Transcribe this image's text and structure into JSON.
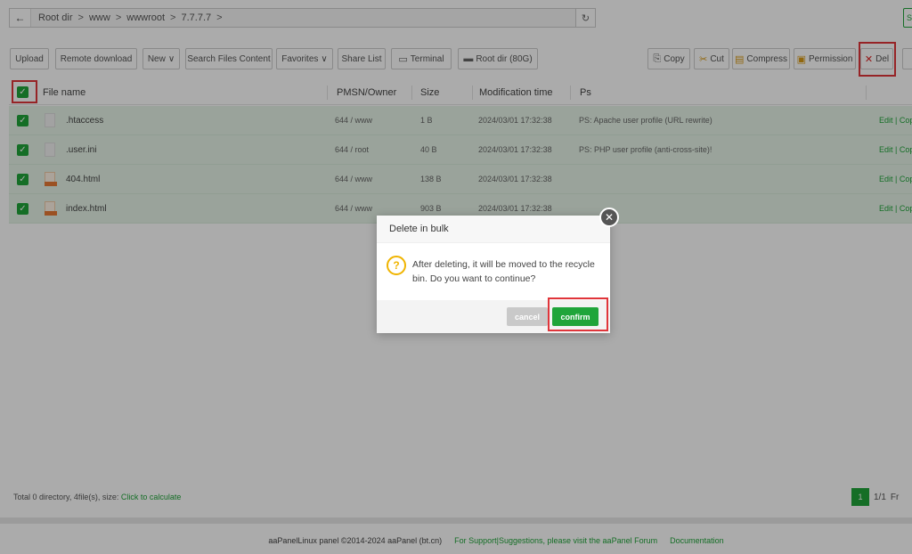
{
  "address_bar": {
    "back_icon": "arrow-left-icon",
    "crumbs": [
      "Root dir",
      "www",
      "wwwroot",
      "7.7.7.7"
    ],
    "separator": ">",
    "refresh_icon": "refresh-icon"
  },
  "corner_button": {
    "label": "S"
  },
  "toolbar": {
    "upload": "Upload",
    "remote_download": "Remote download",
    "new": "New",
    "search_files_content": "Search Files Content",
    "favorites": "Favorites",
    "share_list": "Share List",
    "terminal": "Terminal",
    "root_dir": "Root dir (80G)",
    "copy": "Copy",
    "cut": "Cut",
    "compress": "Compress",
    "permission": "Permission",
    "del": "Del"
  },
  "table": {
    "headers": {
      "filename": "File name",
      "owner": "PMSN/Owner",
      "size": "Size",
      "mtime": "Modification time",
      "ps": "Ps"
    },
    "rows": [
      {
        "name": ".htaccess",
        "owner": "644 / www",
        "size": "1 B",
        "mtime": "2024/03/01 17:32:38",
        "ps": "PS: Apache user profile (URL rewrite)",
        "ops": "Edit | Cop",
        "icon": "text-file-icon"
      },
      {
        "name": ".user.ini",
        "owner": "644 / root",
        "size": "40 B",
        "mtime": "2024/03/01 17:32:38",
        "ps": "PS: PHP user profile (anti-cross-site)!",
        "ops": "Edit | Cop",
        "icon": "text-file-icon"
      },
      {
        "name": "404.html",
        "owner": "644 / www",
        "size": "138 B",
        "mtime": "2024/03/01 17:32:38",
        "ps": "",
        "ops": "Edit | Cop",
        "icon": "html-file-icon"
      },
      {
        "name": "index.html",
        "owner": "644 / www",
        "size": "903 B",
        "mtime": "2024/03/01 17:32:38",
        "ps": "",
        "ops": "Edit | Cop",
        "icon": "html-file-icon"
      }
    ]
  },
  "footer": {
    "stats": "Total 0 directory, 4file(s), size:",
    "calc_link": "Click to calculate",
    "page_current": "1",
    "page_total": "1/1",
    "page_more": "Fr"
  },
  "copyright": {
    "text": "aaPanelLinux panel ©2014-2024 aaPanel (bt.cn)",
    "support": "For Support|Suggestions, please visit the aaPanel Forum",
    "docs": "Documentation"
  },
  "modal": {
    "title": "Delete in bulk",
    "message": "After deleting, it will be moved to the recycle bin. Do you want to continue?",
    "cancel": "cancel",
    "confirm": "confirm"
  },
  "colors": {
    "accent": "#20a53a",
    "highlight": "#e0353a",
    "warning": "#f0b400"
  }
}
